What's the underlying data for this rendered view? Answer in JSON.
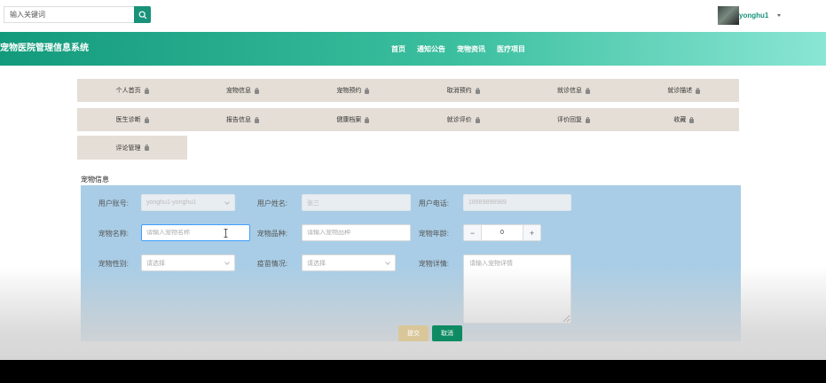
{
  "search": {
    "placeholder": "输入关键词"
  },
  "user": {
    "name": "yonghu1"
  },
  "header": {
    "title": "宠物医院管理信息系统",
    "nav": [
      "首页",
      "通知公告",
      "宠物资讯",
      "医疗项目"
    ]
  },
  "menu": {
    "row1": [
      "个人首页",
      "宠物信息",
      "宠物预约",
      "取消预约",
      "就诊信息",
      "就诊描述"
    ],
    "row2": [
      "医生诊断",
      "报告信息",
      "健康档案",
      "就诊评价",
      "评价回复",
      "收藏"
    ],
    "row3": [
      "评论管理"
    ]
  },
  "section_title": "宠物信息",
  "form": {
    "account_label": "用户账号:",
    "account_value": "yonghu1-yonghu1",
    "name_label": "用户姓名:",
    "name_value": "张三",
    "phone_label": "用户电话:",
    "phone_value": "18989898989",
    "pet_name_label": "宠物名称:",
    "pet_name_placeholder": "请输入宠物名称",
    "breed_label": "宠物品种:",
    "breed_placeholder": "请输入宠物品种",
    "age_label": "宠物年龄:",
    "age_value": "0",
    "gender_label": "宠物性别:",
    "gender_placeholder": "请选择",
    "vaccine_label": "疫苗情况:",
    "vaccine_placeholder": "请选择",
    "detail_label": "宠物详情:",
    "detail_placeholder": "请输入宠物详情",
    "submit_label": "提交",
    "cancel_label": "取消"
  },
  "colors": {
    "accent": "#19927a",
    "panel": "#a9cde6",
    "menu": "#e5ded6",
    "submit": "#d9c79a",
    "cancel": "#0e8b62"
  }
}
